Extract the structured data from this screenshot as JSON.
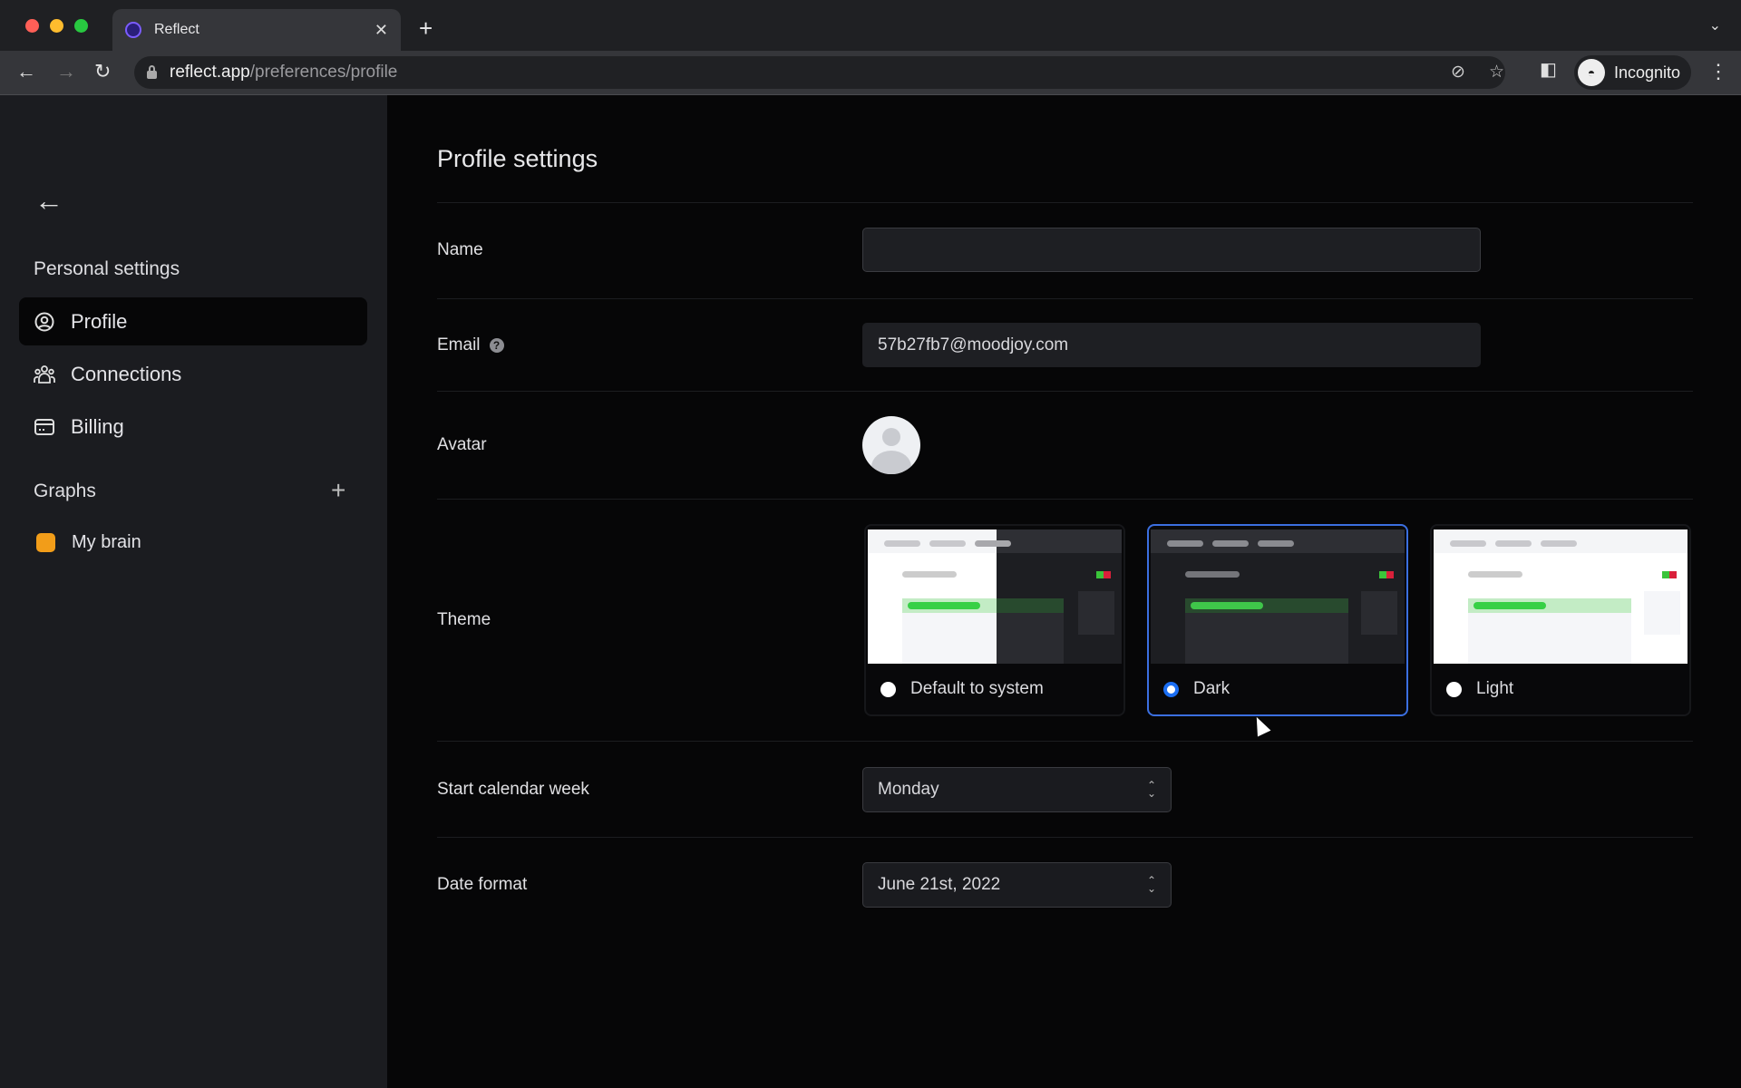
{
  "browser": {
    "tab_title": "Reflect",
    "tab_close": "✕",
    "new_tab": "+",
    "url_host": "reflect.app",
    "url_path": "/preferences/profile",
    "profile_label": "Incognito"
  },
  "sidebar": {
    "section_personal": "Personal settings",
    "items": [
      {
        "label": "Profile",
        "icon": "user-circle-icon",
        "active": true
      },
      {
        "label": "Connections",
        "icon": "users-icon",
        "active": false
      },
      {
        "label": "Billing",
        "icon": "credit-card-icon",
        "active": false
      }
    ],
    "section_graphs": "Graphs",
    "graphs": [
      {
        "label": "My brain",
        "color": "#f29d19"
      }
    ]
  },
  "main": {
    "title": "Profile settings",
    "name": {
      "label": "Name",
      "value": ""
    },
    "email": {
      "label": "Email",
      "value": "57b27fb7@moodjoy.com"
    },
    "avatar": {
      "label": "Avatar"
    },
    "theme": {
      "label": "Theme",
      "options": [
        {
          "label": "Default to system",
          "selected": false
        },
        {
          "label": "Dark",
          "selected": true
        },
        {
          "label": "Light",
          "selected": false
        }
      ]
    },
    "week": {
      "label": "Start calendar week",
      "value": "Monday"
    },
    "date": {
      "label": "Date format",
      "value": "June 21st, 2022"
    }
  },
  "colors": {
    "accent": "#3b6fe0",
    "radio": "#1b6ef3",
    "graph": "#f29d19"
  }
}
